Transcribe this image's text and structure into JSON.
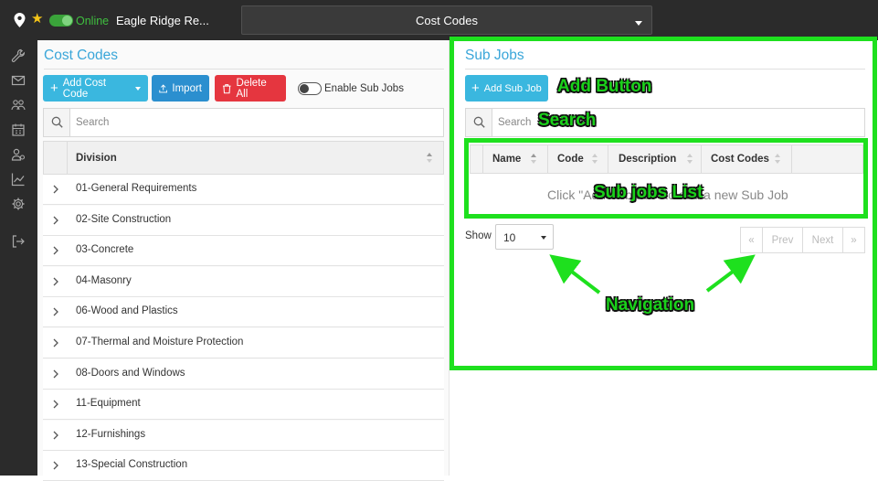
{
  "topbar": {
    "online_label": "Online",
    "job_name": "Eagle Ridge Re...",
    "page_title": "Cost Codes"
  },
  "left_nav": {
    "icons": [
      "wrench-icon",
      "mail-icon",
      "people-icon",
      "calendar-icon",
      "contacts-icon",
      "chart-icon",
      "gear-icon",
      "logout-icon"
    ]
  },
  "cost_codes": {
    "title": "Cost Codes",
    "add_button": "Add Cost Code",
    "import_button": "Import",
    "delete_all_button": "Delete All",
    "enable_sub_jobs_label": "Enable Sub Jobs",
    "search_placeholder": "Search",
    "column_division": "Division",
    "divisions": [
      "01-General Requirements",
      "02-Site Construction",
      "03-Concrete",
      "04-Masonry",
      "06-Wood and Plastics",
      "07-Thermal and Moisture Protection",
      "08-Doors and Windows",
      "11-Equipment",
      "12-Furnishings",
      "13-Special Construction"
    ]
  },
  "sub_jobs": {
    "title": "Sub Jobs",
    "add_button": "Add Sub Job",
    "search_placeholder": "Search",
    "columns": [
      "Name",
      "Code",
      "Description",
      "Cost Codes"
    ],
    "empty_message": "Click \"Add Sub Job\" to add a new Sub Job",
    "show_label": "Show",
    "page_size": "10",
    "pager": {
      "first": "«",
      "prev": "Prev",
      "next": "Next",
      "last": "»"
    }
  },
  "annotations": {
    "add_button": "Add Button",
    "search": "Search",
    "sub_jobs_list": "Sub jobs List",
    "navigation": "Navigation"
  },
  "colors": {
    "accent": "#3aa6d9",
    "annotation_green": "#1ee01e",
    "danger": "#e5363f",
    "online": "#3fbf3f"
  }
}
